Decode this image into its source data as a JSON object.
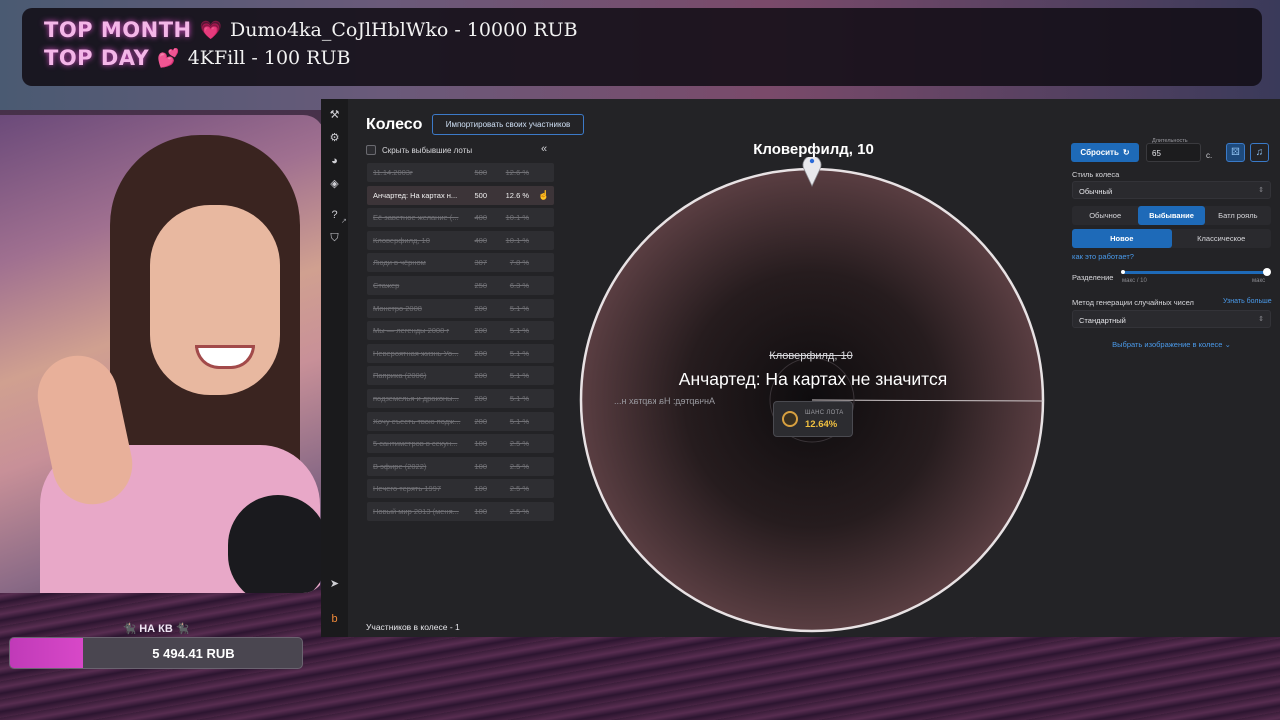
{
  "overlay": {
    "top_month_label": "TOP MONTH",
    "top_month_value": "Dumo4ka_CoJlHblWko - 10000 RUB",
    "top_day_label": "TOP DAY",
    "top_day_value": "4KFill - 100 RUB",
    "goal_label": "🐈‍⬛ НА КВ 🐈‍⬛",
    "goal_value": "5 494.41 RUB",
    "goal_progress": 0.25
  },
  "app": {
    "title": "Колесо",
    "import_button": "Импортировать своих участников",
    "hide_dropped_label": "Скрыть выбывшие лоты",
    "collapse_icon": "double-chevron-left",
    "lots": [
      {
        "name": "11.14.2003г",
        "amount": "500",
        "percent": "12.6 %",
        "out": true
      },
      {
        "name": "Анчартед: На картах н...",
        "amount": "500",
        "percent": "12.6 %",
        "out": false,
        "active": true
      },
      {
        "name": "Её заветное желание (...",
        "amount": "400",
        "percent": "10.1 %",
        "out": true
      },
      {
        "name": "Кловерфилд, 10",
        "amount": "400",
        "percent": "10.1 %",
        "out": true
      },
      {
        "name": "Люди в чёрном",
        "amount": "307",
        "percent": "7.8 %",
        "out": true
      },
      {
        "name": "Стажер",
        "amount": "250",
        "percent": "6.3 %",
        "out": true
      },
      {
        "name": "Монстро 2008",
        "amount": "200",
        "percent": "5.1 %",
        "out": true
      },
      {
        "name": "Мы — легенды 2008 г",
        "amount": "200",
        "percent": "5.1 %",
        "out": true
      },
      {
        "name": "Невероятная жизнь Уо...",
        "amount": "200",
        "percent": "5.1 %",
        "out": true
      },
      {
        "name": "Паприка (2006)",
        "amount": "200",
        "percent": "5.1 %",
        "out": true
      },
      {
        "name": "подземелья и драконы...",
        "amount": "200",
        "percent": "5.1 %",
        "out": true
      },
      {
        "name": "Хочу съесть твою подж...",
        "amount": "200",
        "percent": "5.1 %",
        "out": true
      },
      {
        "name": "5 сантиметров в секун...",
        "amount": "100",
        "percent": "2.5 %",
        "out": true
      },
      {
        "name": "В эфире (2022)",
        "amount": "100",
        "percent": "2.5 %",
        "out": true
      },
      {
        "name": "Нечего терять 1997",
        "amount": "100",
        "percent": "2.5 %",
        "out": true
      },
      {
        "name": "Новый мир 2013 (меня...",
        "amount": "100",
        "percent": "2.5 %",
        "out": true
      }
    ],
    "participants": "Участников в колесе - 1",
    "wheel": {
      "top_label": "Кловерфилд, 10",
      "previous_winner": "Кловерфилд, 10",
      "current_winner": "Анчартед: На картах не значится",
      "mirrored_label": "Анчартед: На картах н...",
      "chance_caption": "ШАНС ЛОТА",
      "chance_value": "12.64%"
    },
    "settings": {
      "reset_button": "Сбросить",
      "duration_label": "Длительность",
      "duration_value": "65",
      "duration_unit": "с.",
      "wheel_style_label": "Стиль колеса",
      "wheel_style_value": "Обычный",
      "mode_tabs": [
        "Обычное",
        "Выбывание",
        "Батл рояль"
      ],
      "mode_selected": 1,
      "variant_tabs": [
        "Новое",
        "Классическое"
      ],
      "variant_selected": 0,
      "how_it_works": "как это работает?",
      "split_label": "Разделение",
      "split_min": "макс / 10",
      "split_max": "макс",
      "rng_label": "Метод генерации случайных чисел",
      "rng_learn_more": "Узнать больше",
      "rng_value": "Стандартный",
      "choose_image": "Выбрать изображение в колесе"
    }
  }
}
